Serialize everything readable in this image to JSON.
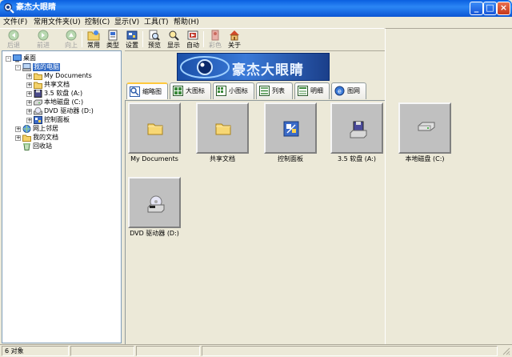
{
  "window": {
    "title": "豪杰大眼睛"
  },
  "menu": [
    {
      "label": "文件(F)"
    },
    {
      "label": "常用文件夹(U)"
    },
    {
      "label": "控制(C)"
    },
    {
      "label": "显示(V)"
    },
    {
      "label": "工具(T)"
    },
    {
      "label": "帮助(H)"
    }
  ],
  "toolbar": {
    "back": "后退",
    "forward": "前进",
    "up": "向上",
    "common": "常用",
    "type": "类型",
    "settings": "设置",
    "preview": "预览",
    "display": "显示",
    "auto": "自动",
    "color": "彩色",
    "about": "关于"
  },
  "tree": {
    "items": [
      {
        "label": "桌面",
        "icon": "desktop-icon",
        "exp": "-"
      },
      {
        "label": "我的电脑",
        "icon": "computer-icon",
        "exp": "-",
        "selected": true
      },
      {
        "label": "My Documents",
        "icon": "folder-icon",
        "exp": "+"
      },
      {
        "label": "共享文档",
        "icon": "folder-icon",
        "exp": "+"
      },
      {
        "label": "3.5 软盘 (A:)",
        "icon": "floppy-icon",
        "exp": "+"
      },
      {
        "label": "本地磁盘 (C:)",
        "icon": "harddisk-icon",
        "exp": "+"
      },
      {
        "label": "DVD 驱动器 (D:)",
        "icon": "dvd-icon",
        "exp": "+"
      },
      {
        "label": "控制面板",
        "icon": "control-panel-icon",
        "exp": "+"
      },
      {
        "label": "网上邻居",
        "icon": "network-icon",
        "exp": "+"
      },
      {
        "label": "我的文档",
        "icon": "folder-icon",
        "exp": "+"
      },
      {
        "label": "回收站",
        "icon": "recycle-bin-icon",
        "exp": ""
      }
    ]
  },
  "banner": {
    "text": "豪杰大眼睛"
  },
  "tabs": [
    {
      "label": "缩略图",
      "active": true
    },
    {
      "label": "大图标"
    },
    {
      "label": "小图标"
    },
    {
      "label": "列表"
    },
    {
      "label": "明细"
    },
    {
      "label": "图网"
    }
  ],
  "thumbnails": [
    {
      "label": "My Documents",
      "icon": "folder-icon"
    },
    {
      "label": "共享文档",
      "icon": "folder-icon"
    },
    {
      "label": "控制面板",
      "icon": "control-panel-icon"
    },
    {
      "label": "3.5 软盘 (A:)",
      "icon": "floppy-icon"
    },
    {
      "label": "本地磁盘 (C:)",
      "icon": "harddisk-icon"
    },
    {
      "label": "DVD 驱动器 (D:)",
      "icon": "dvd-icon"
    }
  ],
  "status": {
    "count": "6 对象"
  }
}
